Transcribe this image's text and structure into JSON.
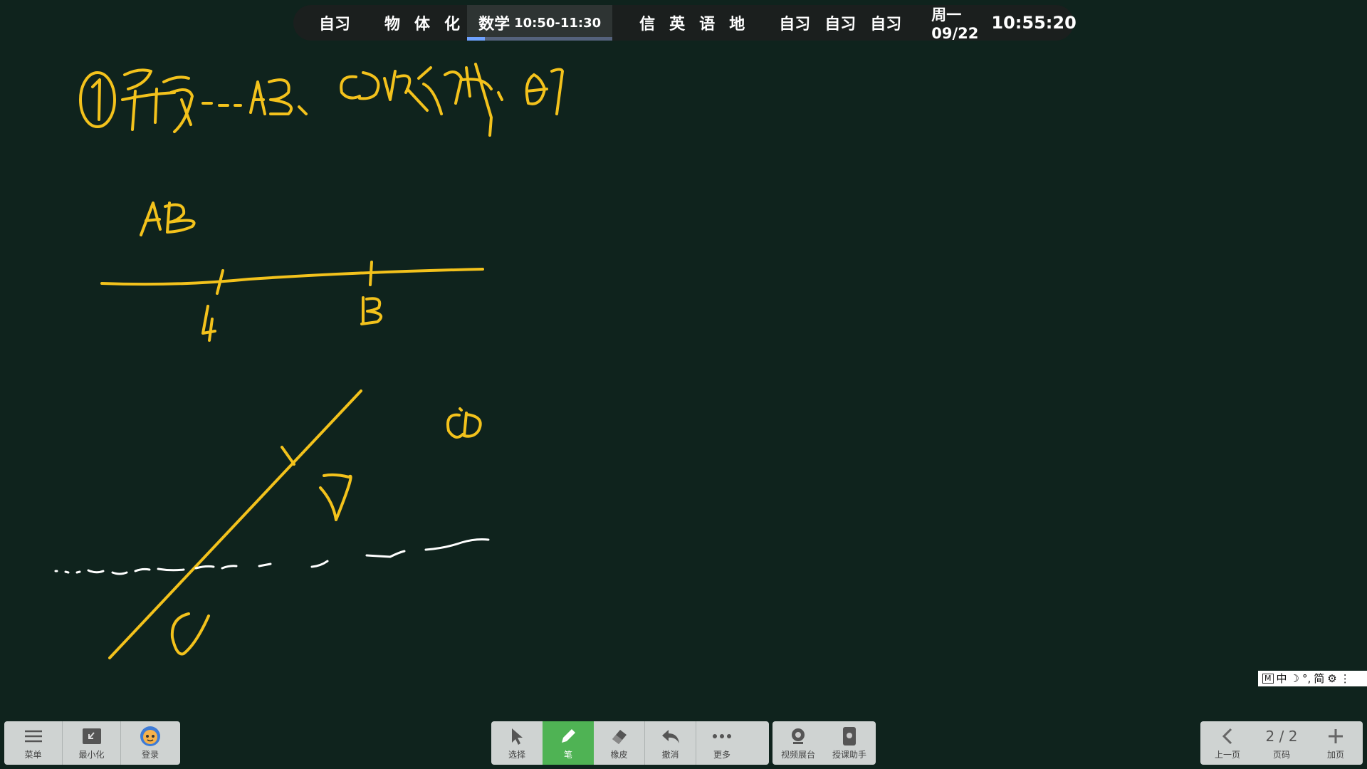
{
  "schedule": {
    "slots_a": [
      "自习"
    ],
    "slots_b": [
      "物",
      "体",
      "化"
    ],
    "active": {
      "subject": "数学",
      "time": "10:50-11:30",
      "progress": 0.12
    },
    "slots_c": [
      "信",
      "英",
      "语",
      "地"
    ],
    "slots_d": [
      "自习",
      "自习",
      "自习"
    ],
    "date": "周一 09/22",
    "clock": "10:55:20"
  },
  "board": {
    "pen_color": "#f3c21c",
    "guide_color": "#ffffff"
  },
  "ime": {
    "mode_icon": "M",
    "lang": "中",
    "moon_icon": "moon-icon",
    "punct": "°,",
    "script": "简",
    "settings_icon": "gear-icon",
    "more_icon": "more-icon"
  },
  "toolbar_left": {
    "menu": "菜单",
    "minimize": "最小化",
    "login": "登录"
  },
  "toolbar_center": {
    "select": "选择",
    "pen": "笔",
    "eraser": "橡皮",
    "undo": "撤消",
    "more": "更多"
  },
  "toolbar_right": {
    "camera": "视频展台",
    "assistant": "授课助手"
  },
  "pager": {
    "prev": "上一页",
    "page": "2 / 2",
    "page_label": "页码",
    "add": "加页"
  },
  "colors": {
    "background": "#0f231d",
    "active_tool": "#4fb354",
    "progress": "#6fa2ff"
  }
}
